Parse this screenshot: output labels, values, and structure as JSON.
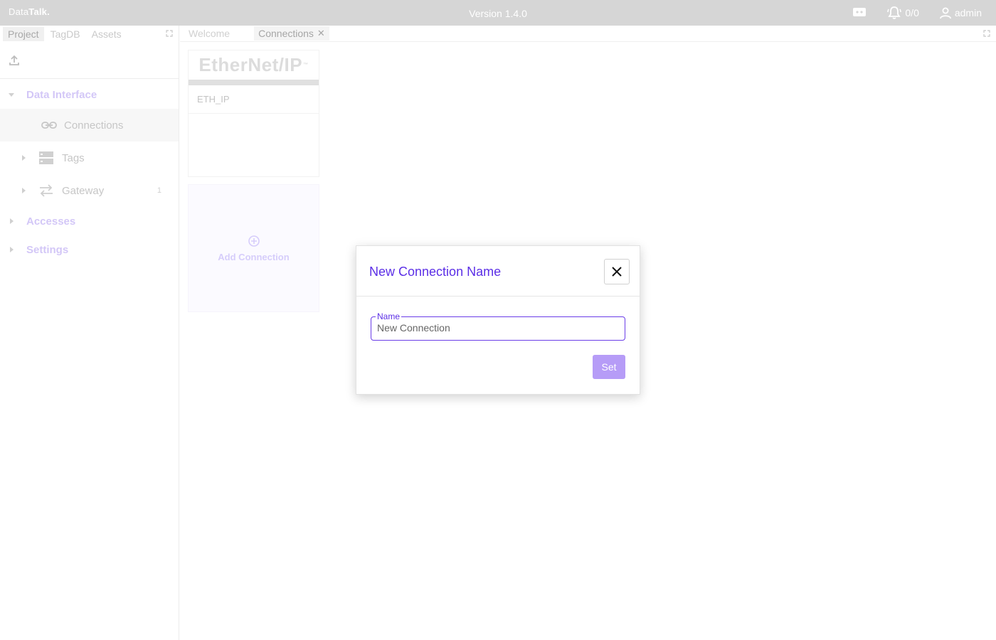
{
  "topbar": {
    "logo_prefix": "Data",
    "logo_bold": "Talk.",
    "version": "Version 1.4.0",
    "alarms": "0/0",
    "user": "admin"
  },
  "left_panel": {
    "tabs": [
      "Project",
      "TagDB",
      "Assets"
    ],
    "sections": {
      "data_interface": "Data Interface",
      "accesses": "Accesses",
      "settings": "Settings"
    },
    "items": {
      "connections": "Connections",
      "tags": "Tags",
      "gateway": "Gateway",
      "gateway_count": "1"
    }
  },
  "main": {
    "tabs": [
      "Welcome",
      "Connections"
    ],
    "connection_card": {
      "logo_text": "EtherNet/IP",
      "logo_tm": "™",
      "name": "ETH_IP"
    },
    "add_connection": "Add Connection"
  },
  "dialog": {
    "title": "New Connection Name",
    "field_label": "Name",
    "field_value": "New Connection",
    "set_label": "Set"
  },
  "colors": {
    "accent": "#5b2ee6",
    "button": "#b69cf7",
    "topbar": "#d6d6d6"
  }
}
